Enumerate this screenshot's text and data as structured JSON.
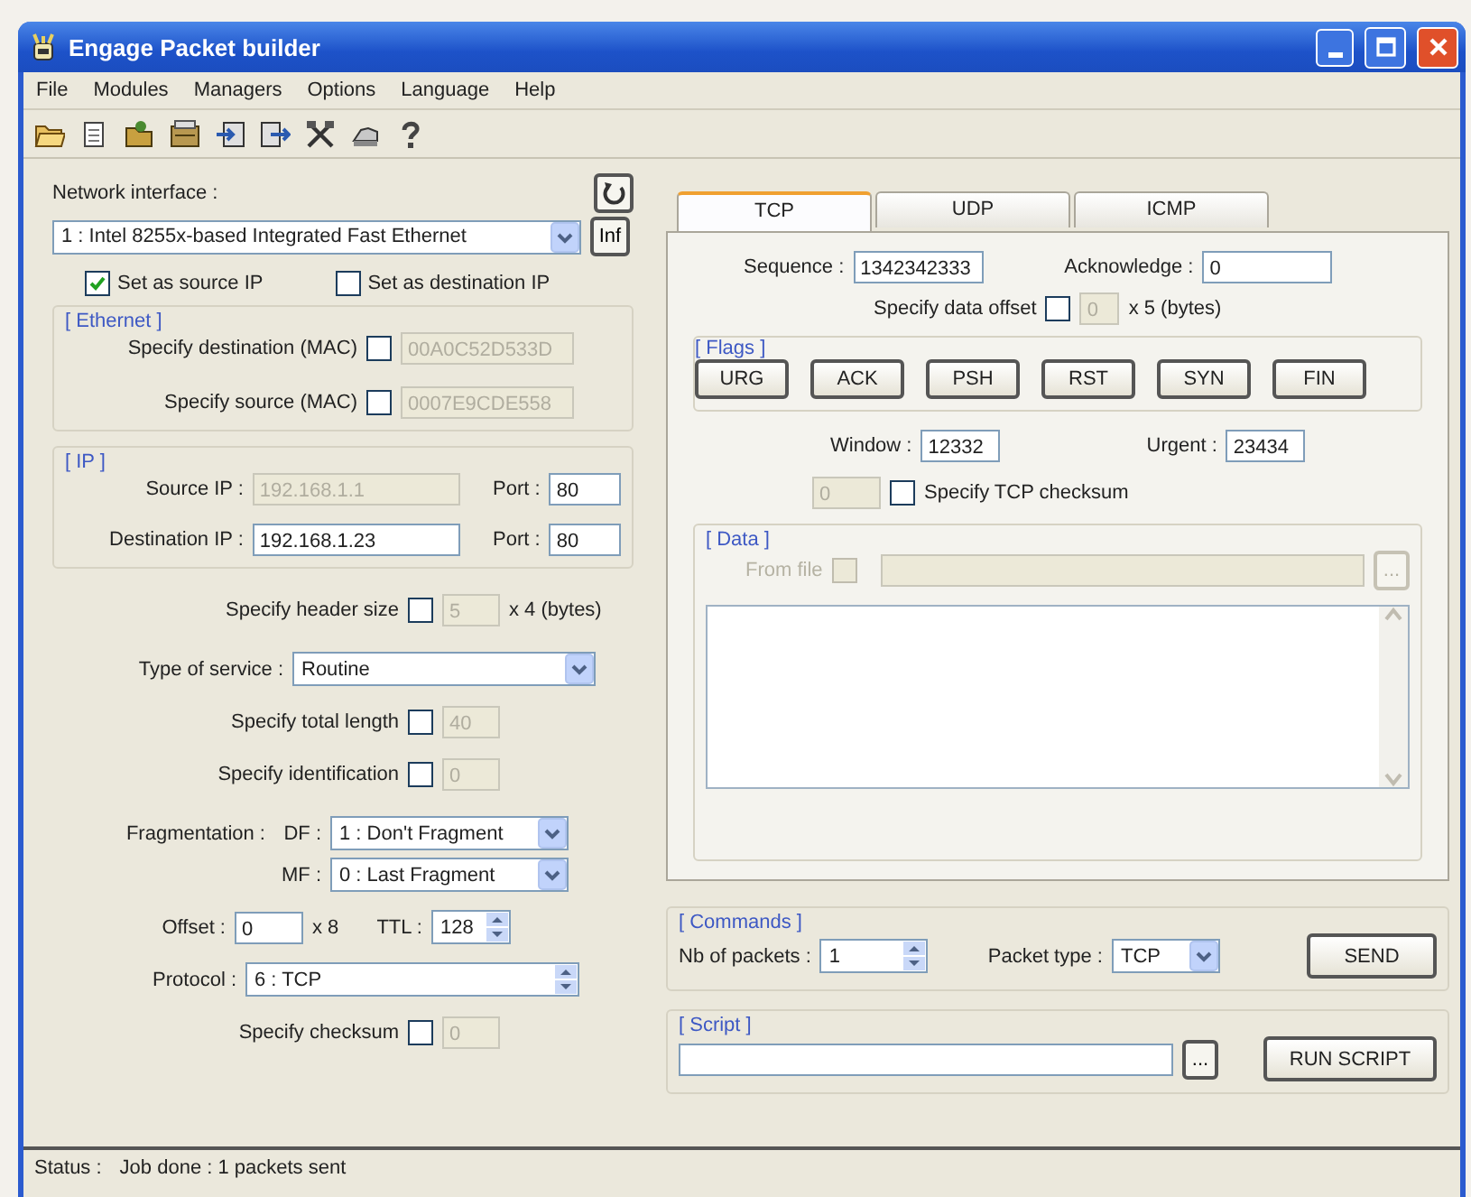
{
  "window": {
    "title": "Engage Packet builder"
  },
  "menu": [
    "File",
    "Modules",
    "Managers",
    "Options",
    "Language",
    "Help"
  ],
  "interface": {
    "label": "Network interface :",
    "value": "1 :  Intel 8255x-based Integrated Fast Ethernet",
    "info_button": "Inf",
    "checks": [
      {
        "label": "Set as source IP",
        "checked": true
      },
      {
        "label": "Set as destination IP",
        "checked": false
      }
    ]
  },
  "ethernet": {
    "title": "[ Ethernet ]",
    "rows": [
      {
        "label": "Specify destination (MAC)",
        "checked": false,
        "value": "00A0C52D533D",
        "disabled": true
      },
      {
        "label": "Specify source (MAC)",
        "checked": false,
        "value": "0007E9CDE558",
        "disabled": true
      }
    ]
  },
  "ip": {
    "title": "[ IP ]",
    "rows": [
      {
        "label": "Source IP :",
        "value": "192.168.1.1",
        "disabled": true,
        "port_label": "Port :",
        "port": "80"
      },
      {
        "label": "Destination IP :",
        "value": "192.168.1.23",
        "disabled": false,
        "port_label": "Port :",
        "port": "80"
      }
    ]
  },
  "ip_options": [
    {
      "kind": "check",
      "label": "Specify header size",
      "checked": false,
      "value": "5",
      "disabled": true,
      "suffix": "x 4 (bytes)"
    },
    {
      "kind": "select",
      "label": "Type of service :",
      "value": "Routine"
    },
    {
      "kind": "check",
      "label": "Specify total length",
      "checked": false,
      "value": "40",
      "disabled": true
    },
    {
      "kind": "check",
      "label": "Specify identification",
      "checked": false,
      "value": "0",
      "disabled": true
    },
    {
      "kind": "fragment",
      "label": "Fragmentation :",
      "sub_label": "DF :",
      "value": "1 : Don't Fragment"
    },
    {
      "kind": "fragment",
      "sub_label": "MF :",
      "value": "0 : Last Fragment"
    },
    {
      "kind": "offset",
      "label": "Offset :",
      "value": "0",
      "suffix": "x 8",
      "ttl_label": "TTL :",
      "ttl": "128"
    },
    {
      "kind": "spin_select",
      "label": "Protocol :",
      "value": "6 : TCP"
    },
    {
      "kind": "check",
      "label": "Specify checksum",
      "checked": false,
      "value": "0",
      "disabled": true
    }
  ],
  "tabs": [
    {
      "label": "TCP",
      "selected": true
    },
    {
      "label": "UDP",
      "selected": false
    },
    {
      "label": "ICMP",
      "selected": false
    }
  ],
  "tcp": {
    "sequence": {
      "label": "Sequence :",
      "value": "1342342333"
    },
    "acknowledge": {
      "label": "Acknowledge :",
      "value": "0"
    },
    "data_offset": {
      "label": "Specify data offset",
      "checked": false,
      "value": "0",
      "disabled": true,
      "suffix": "x 5  (bytes)"
    },
    "flags": {
      "title": "[ Flags ]",
      "buttons": [
        "URG",
        "ACK",
        "PSH",
        "RST",
        "SYN",
        "FIN"
      ]
    },
    "window_size": {
      "label": "Window :",
      "value": "12332"
    },
    "urgent": {
      "label": "Urgent :",
      "value": "23434"
    },
    "checksum": {
      "label": "Specify TCP checksum",
      "checked": false,
      "value": "0",
      "disabled": true
    },
    "data": {
      "title": "[ Data ]",
      "from_file": {
        "label": "From file",
        "checked": false,
        "disabled": true
      },
      "browse": "..."
    }
  },
  "commands": {
    "title": "[ Commands ]",
    "packets_label": "Nb of packets :",
    "packets": "1",
    "type_label": "Packet type :",
    "type": "TCP",
    "send": "SEND"
  },
  "script": {
    "title": "[ Script ]",
    "browse": "...",
    "run": "RUN SCRIPT"
  },
  "status": {
    "label": "Status :",
    "text": "Job done : 1 packets sent"
  }
}
